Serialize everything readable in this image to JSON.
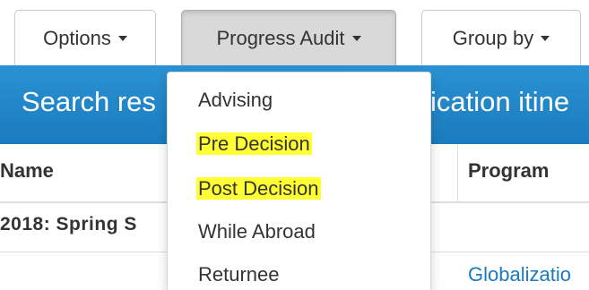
{
  "toolbar": {
    "options_label": "Options",
    "progress_audit_label": "Progress Audit",
    "group_by_label": "Group by"
  },
  "banner": {
    "left_text": "Search res",
    "right_text": "ication itine"
  },
  "table": {
    "columns": [
      "Name",
      "Program"
    ],
    "group_label": "2018: Spring S",
    "row_program_link": "Globalizatio"
  },
  "dropdown": {
    "items": [
      {
        "label": "Advising",
        "highlighted": false
      },
      {
        "label": "Pre Decision",
        "highlighted": true
      },
      {
        "label": "Post Decision",
        "highlighted": true
      },
      {
        "label": "While Abroad",
        "highlighted": false
      },
      {
        "label": "Returnee",
        "highlighted": false
      }
    ]
  },
  "colors": {
    "banner": "#1c84c6",
    "highlight": "#ffff33",
    "link": "#1a7bbd"
  }
}
